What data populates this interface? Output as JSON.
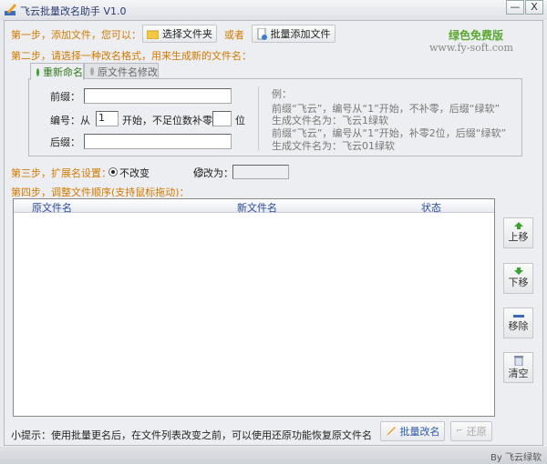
{
  "window": {
    "title": "飞云批量改名助手 V1.0",
    "minimize_label": "—",
    "close_label": "X"
  },
  "step1": {
    "label": "第一步，添加文件，您可以：",
    "select_folder": "选择文件夹",
    "or": "或者",
    "batch_add": "批量添加文件"
  },
  "brand": {
    "free": "绿色免费版",
    "site": "www.fy-soft.com",
    "colors": {
      "free": "#5aa832",
      "orange": "#d27a00"
    }
  },
  "step2": {
    "label": "第二步，请选择一种改名格式，用来生成新的文件名："
  },
  "tabs": [
    {
      "label": "重新命名",
      "active": true
    },
    {
      "label": "原文件名修改",
      "active": false
    }
  ],
  "rename": {
    "prefix_label": "前缀：",
    "prefix_value": "",
    "number_label": "编号：从",
    "number_start": "1",
    "number_mid": "开始，不足位数补零",
    "pad_value": "",
    "pad_unit": "位",
    "suffix_label": "后缀：",
    "suffix_value": ""
  },
  "example": [
    "例：",
    "前缀“飞云”，编号从“1”开始，不补零，后缀“绿软”",
    "生成文件名为：飞云1绿软",
    "前缀“飞云”，编号从“1”开始，补零2位，后缀“绿软”",
    "生成文件名为：飞云01绿软"
  ],
  "step3": {
    "label": "第三步，扩展名设置：",
    "keep": "不改变",
    "change": "修改为：",
    "selected": "keep",
    "ext_value": ""
  },
  "step4": {
    "label": "第四步，调整文件顺序(支持鼠标拖动)："
  },
  "list": {
    "columns": [
      "原文件名",
      "新文件名",
      "状态"
    ],
    "rows": []
  },
  "side_buttons": [
    {
      "label": "上移",
      "icon": "arrow-up-icon"
    },
    {
      "label": "下移",
      "icon": "arrow-down-icon"
    },
    {
      "label": "移除",
      "icon": "minus-icon"
    },
    {
      "label": "清空",
      "icon": "trash-icon"
    }
  ],
  "footer": {
    "tip": "小提示：使用批量更名后，在文件列表改变之前，可以使用还原功能恢复原文件名",
    "rename_button": "批量改名",
    "restore_button": "还原"
  },
  "status": {
    "by": "By 飞云绿软"
  }
}
